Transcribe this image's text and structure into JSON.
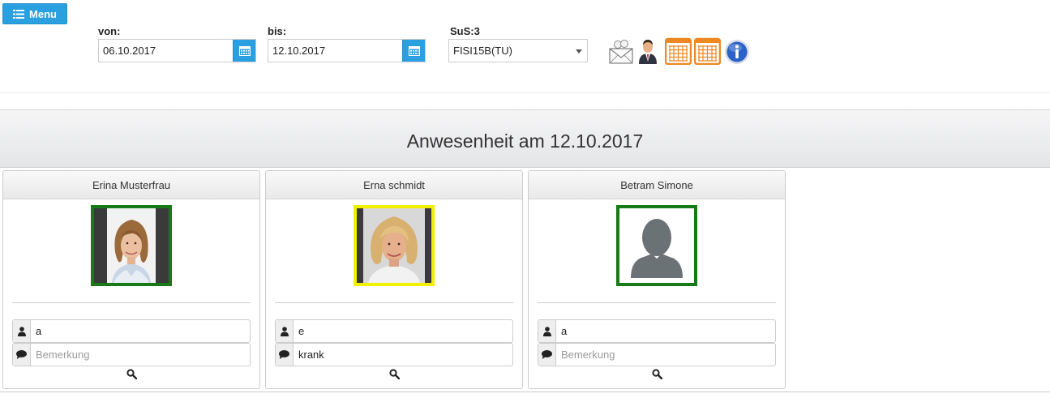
{
  "toolbar": {
    "menu_label": "Menu",
    "from_label": "von:",
    "from_value": "06.10.2017",
    "to_label": "bis:",
    "to_value": "12.10.2017",
    "sus_label": "SuS:3",
    "class_selected": "FISI15B(TU)",
    "tools": [
      "mail-icon",
      "teacher-icon",
      "calendar-icon",
      "calendar-icon",
      "info-icon"
    ]
  },
  "banner": {
    "title": "Anwesenheit am 12.10.2017"
  },
  "students": [
    {
      "name": "Erina Musterfrau",
      "status_value": "a",
      "remark_value": "",
      "remark_placeholder": "Bemerkung",
      "frame_color": "#167a16"
    },
    {
      "name": "Erna schmidt",
      "status_value": "e",
      "remark_value": "krank",
      "remark_placeholder": "Bemerkung",
      "frame_color": "#f0f000"
    },
    {
      "name": "Betram Simone",
      "status_value": "a",
      "remark_value": "",
      "remark_placeholder": "Bemerkung",
      "frame_color": "#167a16"
    }
  ],
  "colors": {
    "accent": "#2aa0e0",
    "present": "#167a16",
    "excused": "#f0f000",
    "calendar_orange": "#ee8822",
    "info_blue": "#2a62c8"
  }
}
